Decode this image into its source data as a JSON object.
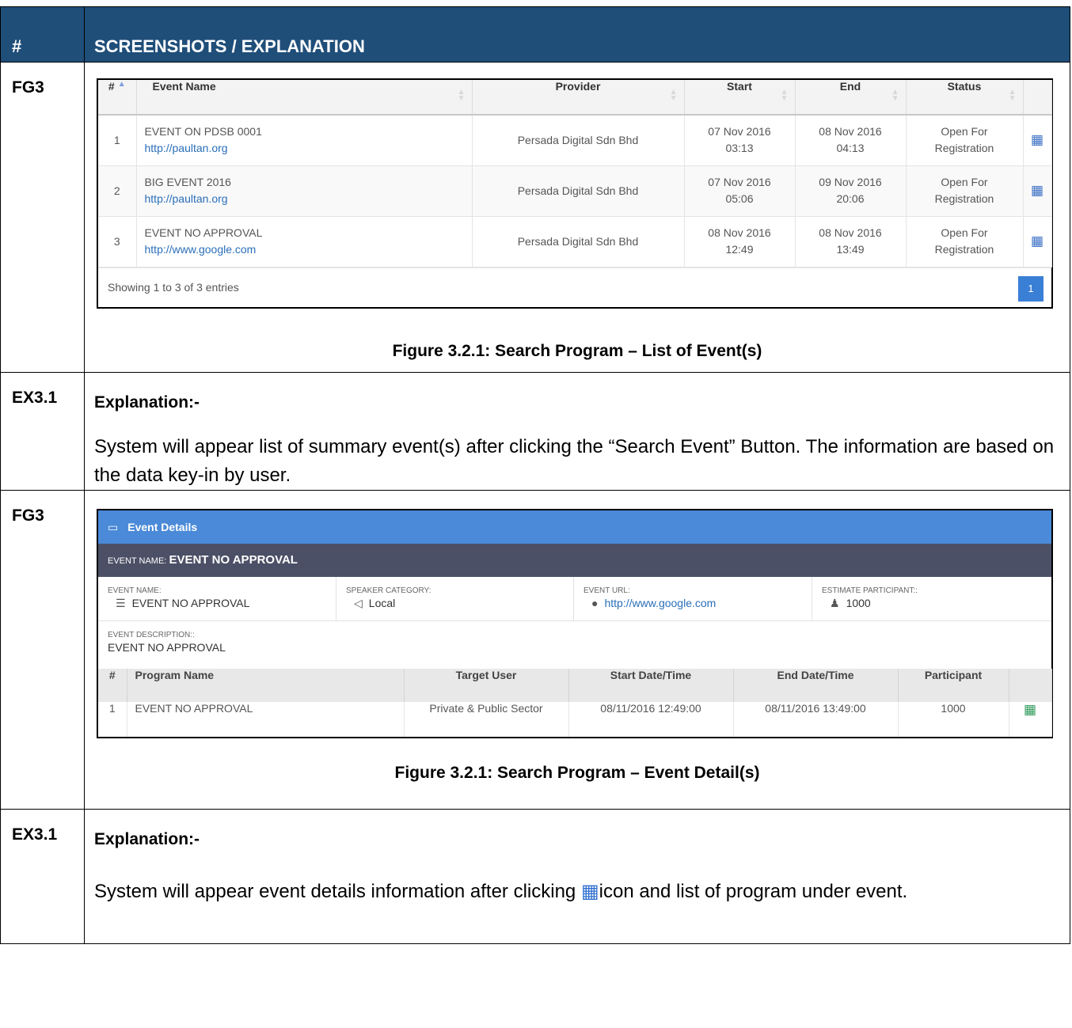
{
  "header": {
    "col1": "#",
    "col2": "SCREENSHOTS / EXPLANATION"
  },
  "rows": [
    {
      "id": "FG3",
      "caption": "Figure 3.2.1: Search Program – List of Event(s)"
    },
    {
      "id": "EX3.1",
      "title": "Explanation:-",
      "text": "System will appear list of summary event(s) after clicking the “Search Event” Button. The information are based on the data key-in by user."
    },
    {
      "id": "FG3",
      "caption": "Figure 3.2.1: Search Program – Event Detail(s)"
    },
    {
      "id": "EX3.1",
      "title": "Explanation:-",
      "text_before": "System will appear event details information after clicking",
      "text_after": "icon and list of program under event."
    }
  ],
  "event_list": {
    "columns": [
      "#",
      "Event Name",
      "Provider",
      "Start",
      "End",
      "Status"
    ],
    "rows": [
      {
        "no": "1",
        "name": "EVENT ON PDSB 0001",
        "url": "http://paultan.org",
        "provider": "Persada Digital Sdn Bhd",
        "start_date": "07 Nov 2016",
        "start_time": "03:13",
        "end_date": "08 Nov 2016",
        "end_time": "04:13",
        "status_1": "Open For",
        "status_2": "Registration"
      },
      {
        "no": "2",
        "name": "BIG EVENT 2016",
        "url": "http://paultan.org",
        "provider": "Persada Digital Sdn Bhd",
        "start_date": "07 Nov 2016",
        "start_time": "05:06",
        "end_date": "09 Nov 2016",
        "end_time": "20:06",
        "status_1": "Open For",
        "status_2": "Registration"
      },
      {
        "no": "3",
        "name": "EVENT NO APPROVAL",
        "url": "http://www.google.com",
        "provider": "Persada Digital Sdn Bhd",
        "start_date": "08 Nov 2016",
        "start_time": "12:49",
        "end_date": "08 Nov 2016",
        "end_time": "13:49",
        "status_1": "Open For",
        "status_2": "Registration"
      }
    ],
    "footer": "Showing 1 to 3 of 3 entries",
    "page": "1"
  },
  "event_details": {
    "panel_title": "Event Details",
    "band_label": "EVENT NAME:",
    "band_value": "EVENT NO APPROVAL",
    "fields": [
      {
        "label": "EVENT NAME:",
        "value": "EVENT NO APPROVAL",
        "icon": "list-icon"
      },
      {
        "label": "SPEAKER CATEGORY:",
        "value": "Local",
        "icon": "bullhorn-icon"
      },
      {
        "label": "EVENT URL:",
        "value": "http://www.google.com",
        "icon": "globe-icon"
      },
      {
        "label": "ESTIMATE PARTICIPANT::",
        "value": "1000",
        "icon": "users-icon"
      }
    ],
    "desc_label": "EVENT DESCRIPTION::",
    "desc_value": "EVENT NO APPROVAL",
    "program_columns": [
      "#",
      "Program Name",
      "Target User",
      "Start Date/Time",
      "End Date/Time",
      "Participant"
    ],
    "programs": [
      {
        "no": "1",
        "name": "EVENT NO APPROVAL",
        "target": "Private & Public Sector",
        "start": "08/11/2016 12:49:00",
        "end": "08/11/2016 13:49:00",
        "participant": "1000"
      }
    ]
  },
  "colors": {
    "header_bg": "#1f4e79",
    "panel_blue": "#4a8ad8",
    "band_dark": "#4b5066",
    "link": "#2a6eb8"
  }
}
